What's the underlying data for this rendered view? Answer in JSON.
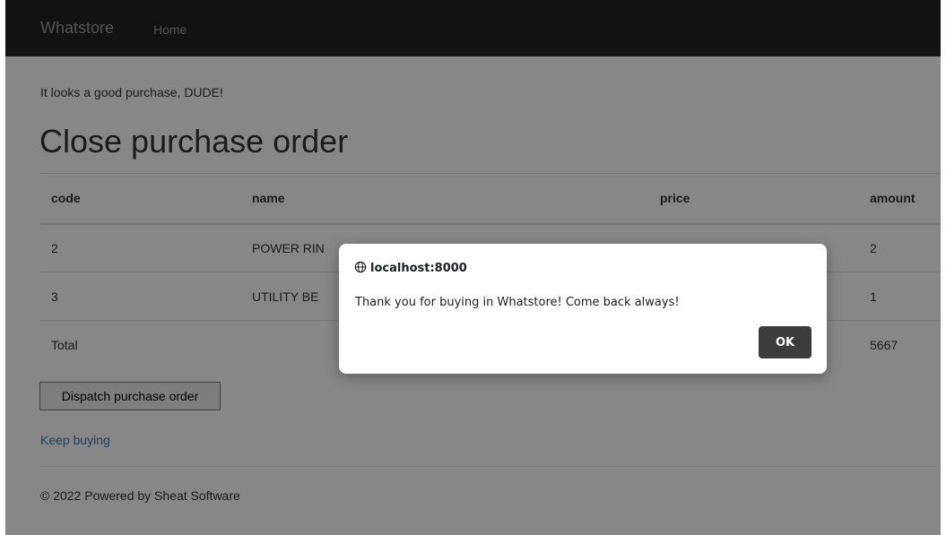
{
  "navbar": {
    "brand": "Whatstore",
    "home_link": "Home"
  },
  "page": {
    "message": "It looks a good purchase, DUDE!",
    "title": "Close purchase order"
  },
  "table": {
    "headers": [
      "code",
      "name",
      "price",
      "amount"
    ],
    "rows": [
      {
        "code": "2",
        "name": "POWER RIN",
        "price": "",
        "amount": "2"
      },
      {
        "code": "3",
        "name": "UTILITY BE",
        "price": "",
        "amount": "1"
      }
    ],
    "total": {
      "label": "Total",
      "amount": "5667"
    }
  },
  "actions": {
    "dispatch_label": "Dispatch purchase order",
    "keep_buying_label": "Keep buying"
  },
  "footer": {
    "text": "© 2022 Powered by Sheat Software"
  },
  "dialog": {
    "origin": "localhost:8000",
    "message": "Thank you for buying in Whatstore! Come back always!",
    "ok_label": "OK"
  },
  "colors": {
    "navbar_bg": "#222222",
    "ok_button_bg": "#3c3c3c",
    "link": "#337ab7"
  }
}
